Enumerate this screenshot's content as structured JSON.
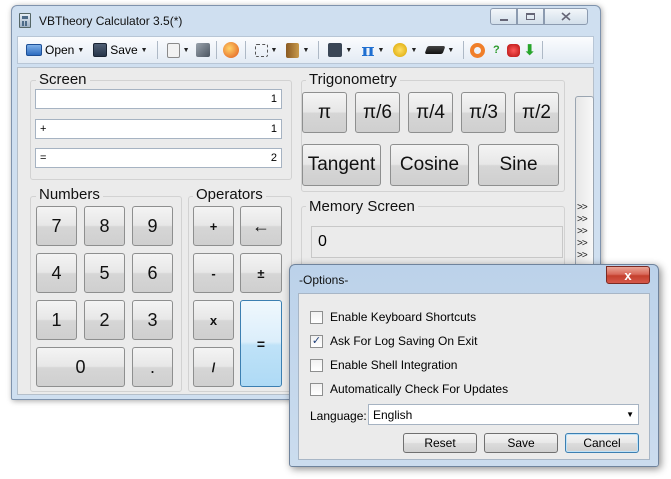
{
  "window": {
    "title": "VBTheory Calculator 3.5(*)"
  },
  "toolbar": {
    "open_label": "Open",
    "save_label": "Save",
    "pi_symbol": "π",
    "help_symbol": "?"
  },
  "screen": {
    "label": "Screen",
    "rows": [
      {
        "op": "",
        "value": "1"
      },
      {
        "op": "+",
        "value": "1"
      },
      {
        "op": "=",
        "value": "2"
      }
    ]
  },
  "numbers": {
    "label": "Numbers",
    "keys": [
      "7",
      "8",
      "9",
      "4",
      "5",
      "6",
      "1",
      "2",
      "3",
      "0",
      "."
    ]
  },
  "operators": {
    "label": "Operators",
    "add": "+",
    "backspace": "←",
    "subtract": "-",
    "plus_minus": "±",
    "multiply": "x",
    "divide": "/",
    "equals": "="
  },
  "trigonometry": {
    "label": "Trigonometry",
    "pi_keys": [
      "π",
      "π/6",
      "π/4",
      "π/3",
      "π/2"
    ],
    "tangent": "Tangent",
    "cosine": "Cosine",
    "sine": "Sine"
  },
  "memory": {
    "label": "Memory Screen",
    "value": "0"
  },
  "side_chevrons": [
    ">>",
    ">>",
    ">>",
    ">>",
    ">>"
  ],
  "options": {
    "title": "-Options-",
    "close_symbol": "x",
    "items": [
      {
        "label": "Enable Keyboard Shortcuts",
        "checked": false,
        "mark": ""
      },
      {
        "label": "Ask For Log Saving On Exit",
        "checked": true,
        "mark": "✓"
      },
      {
        "label": "Enable Shell Integration",
        "checked": false,
        "mark": ""
      },
      {
        "label": "Automatically Check For Updates",
        "checked": false,
        "mark": ""
      }
    ],
    "language_label": "Language:",
    "language_value": "English",
    "reset_label": "Reset",
    "save_label": "Save",
    "cancel_label": "Cancel"
  }
}
